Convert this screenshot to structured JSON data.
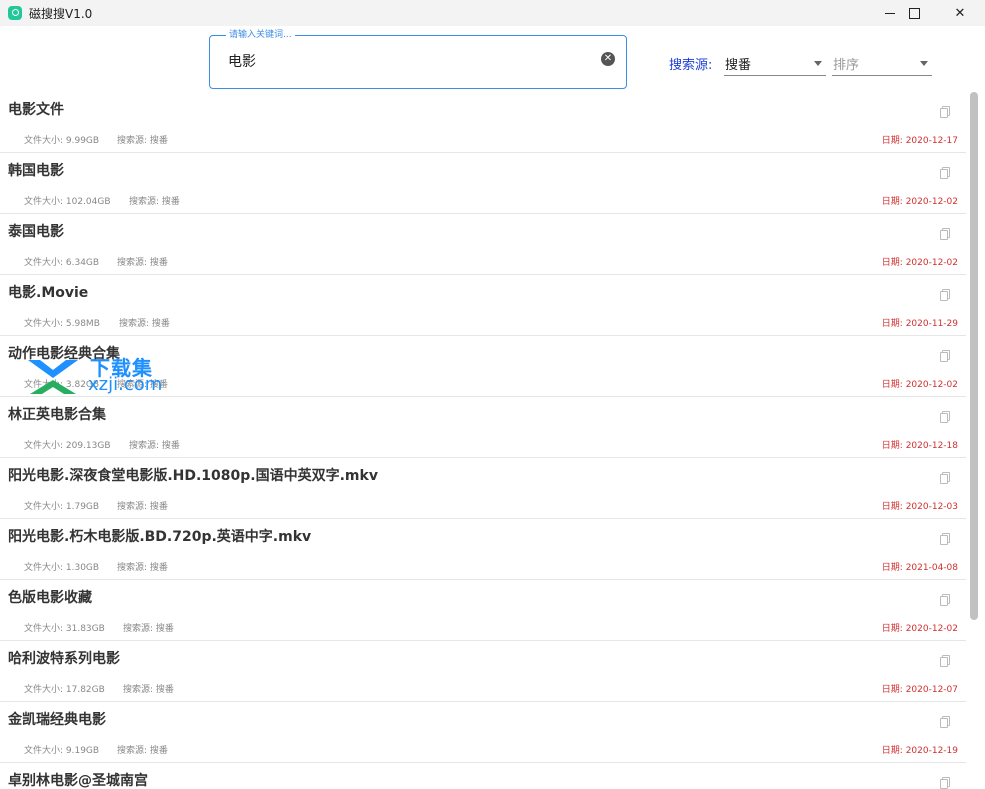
{
  "window": {
    "title": "磁搜搜V1.0"
  },
  "search": {
    "legend": "请输入关键词...",
    "value": "电影",
    "clear_glyph": "✕"
  },
  "source": {
    "label": "搜索源:",
    "selected": "搜番"
  },
  "sort": {
    "placeholder": "排序"
  },
  "watermark": {
    "brand_cn": "下载集",
    "brand_en": "xzji.com"
  },
  "results": [
    {
      "title": "电影文件",
      "size": "文件大小: 9.99GB",
      "source": "搜索源: 搜番",
      "date": "日期: 2020-12-17"
    },
    {
      "title": "韩国电影",
      "size": "文件大小: 102.04GB",
      "source": "搜索源: 搜番",
      "date": "日期: 2020-12-02"
    },
    {
      "title": "泰国电影",
      "size": "文件大小: 6.34GB",
      "source": "搜索源: 搜番",
      "date": "日期: 2020-12-02"
    },
    {
      "title": "电影.Movie",
      "size": "文件大小: 5.98MB",
      "source": "搜索源: 搜番",
      "date": "日期: 2020-11-29"
    },
    {
      "title": "动作电影经典合集",
      "size": "文件大小: 3.82GB",
      "source": "搜索源: 搜番",
      "date": "日期: 2020-12-02"
    },
    {
      "title": "林正英电影合集",
      "size": "文件大小: 209.13GB",
      "source": "搜索源: 搜番",
      "date": "日期: 2020-12-18"
    },
    {
      "title": "阳光电影.深夜食堂电影版.HD.1080p.国语中英双字.mkv",
      "size": "文件大小: 1.79GB",
      "source": "搜索源: 搜番",
      "date": "日期: 2020-12-03"
    },
    {
      "title": "阳光电影.朽木电影版.BD.720p.英语中字.mkv",
      "size": "文件大小: 1.30GB",
      "source": "搜索源: 搜番",
      "date": "日期: 2021-04-08"
    },
    {
      "title": "色版电影收藏",
      "size": "文件大小: 31.83GB",
      "source": "搜索源: 搜番",
      "date": "日期: 2020-12-02"
    },
    {
      "title": "哈利波特系列电影",
      "size": "文件大小: 17.82GB",
      "source": "搜索源: 搜番",
      "date": "日期: 2020-12-07"
    },
    {
      "title": "金凯瑞经典电影",
      "size": "文件大小: 9.19GB",
      "source": "搜索源: 搜番",
      "date": "日期: 2020-12-19"
    },
    {
      "title": "卓别林电影@圣城南宫",
      "size": "",
      "source": "",
      "date": ""
    }
  ],
  "colors": {
    "accent": "#3a8ee6",
    "source_label": "#1a3fd8",
    "date": "#d32f2f",
    "app_icon": "#20c997"
  }
}
